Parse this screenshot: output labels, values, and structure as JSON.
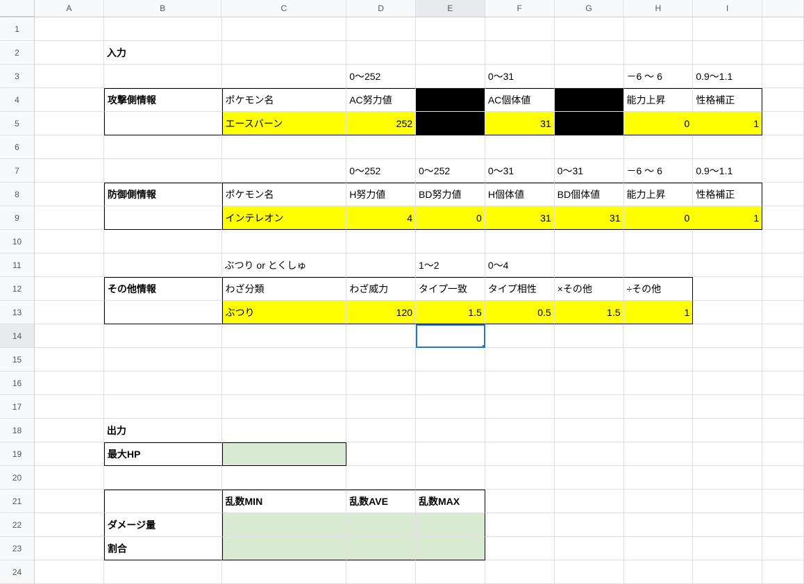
{
  "columns": [
    "A",
    "B",
    "C",
    "D",
    "E",
    "F",
    "G",
    "H",
    "I",
    ""
  ],
  "rows": [
    "1",
    "2",
    "3",
    "4",
    "5",
    "6",
    "7",
    "8",
    "9",
    "10",
    "11",
    "12",
    "13",
    "14",
    "15",
    "16",
    "17",
    "18",
    "19",
    "20",
    "21",
    "22",
    "23",
    "24"
  ],
  "active": {
    "row": 14,
    "col": "E"
  },
  "sections": {
    "input_title": "入力",
    "attacker": {
      "header": "攻撃側情報",
      "labels": {
        "pokemon": "ポケモン名",
        "ac_ev": "AC努力値",
        "ac_iv": "AC個体値",
        "stat_boost": "能力上昇",
        "nature": "性格補正"
      },
      "ranges": {
        "d": "0～252",
        "f": "0～31",
        "h": "－6 ～ 6",
        "i": "0.9～1.1"
      },
      "values": {
        "pokemon": "エースバーン",
        "ac_ev": "252",
        "ac_iv": "31",
        "stat_boost": "0",
        "nature": "1"
      }
    },
    "defender": {
      "header": "防御側情報",
      "labels": {
        "pokemon": "ポケモン名",
        "h_ev": "H努力値",
        "bd_ev": "BD努力値",
        "h_iv": "H個体値",
        "bd_iv": "BD個体値",
        "stat_boost": "能力上昇",
        "nature": "性格補正"
      },
      "ranges": {
        "d": "0～252",
        "e": "0～252",
        "f": "0～31",
        "g": "0～31",
        "h": "－6 ～ 6",
        "i": "0.9～1.1"
      },
      "values": {
        "pokemon": "インテレオン",
        "h_ev": "4",
        "bd_ev": "0",
        "h_iv": "31",
        "bd_iv": "31",
        "stat_boost": "0",
        "nature": "1"
      }
    },
    "other": {
      "header": "その他情報",
      "labels": {
        "move_cat": "わざ分類",
        "move_power": "わざ威力",
        "stab": "タイプ一致",
        "effectiveness": "タイプ相性",
        "mult_other": "×その他",
        "div_other": "÷その他"
      },
      "ranges": {
        "c": "ぶつり or とくしゅ",
        "e": "1～2",
        "f": "0～4"
      },
      "values": {
        "move_cat": "ぶつり",
        "move_power": "120",
        "stab": "1.5",
        "effectiveness": "0.5",
        "mult_other": "1.5",
        "div_other": "1"
      }
    },
    "output": {
      "title": "出力",
      "max_hp": "最大HP",
      "rand_min": "乱数MIN",
      "rand_ave": "乱数AVE",
      "rand_max": "乱数MAX",
      "damage": "ダメージ量",
      "ratio": "割合"
    }
  }
}
